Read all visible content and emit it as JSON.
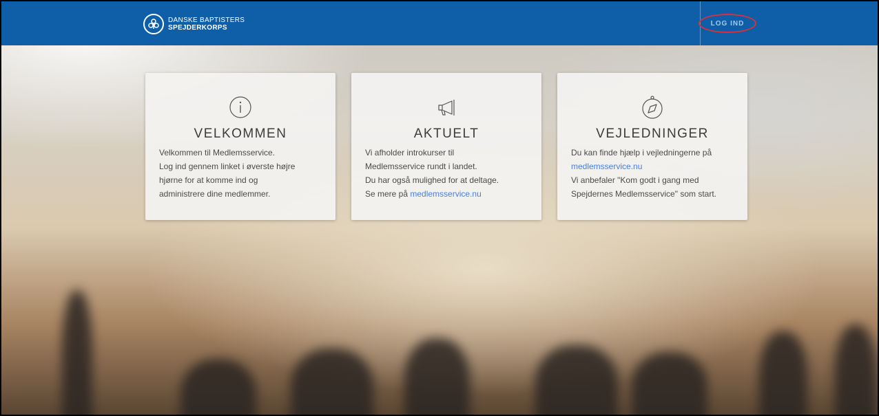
{
  "header": {
    "logo_line1": "DANSKE BAPTISTERS",
    "logo_line2": "SPEJDERKORPS",
    "login_label": "LOG IND"
  },
  "cards": [
    {
      "icon": "info-icon",
      "title": "VELKOMMEN",
      "lines": [
        "Velkommen til Medlemsservice.",
        "Log ind gennem linket i øverste højre",
        "hjørne for at komme ind og",
        "administrere dine medlemmer."
      ]
    },
    {
      "icon": "megaphone-icon",
      "title": "AKTUELT",
      "lines": [
        "Vi afholder introkurser til",
        "Medlemsservice rundt i landet.",
        "Du har også mulighed for at deltage."
      ],
      "link_prefix": "Se mere på ",
      "link_text": "medlemsservice.nu"
    },
    {
      "icon": "compass-icon",
      "title": "VEJLEDNINGER",
      "line1": "Du kan finde hjælp i vejledningerne på",
      "link_text": "medlemsservice.nu",
      "lines_after": [
        "Vi anbefaler \"Kom godt i gang med",
        "Spejdernes Medlemsservice\" som start."
      ]
    }
  ],
  "colors": {
    "topbar": "#0e5fa8",
    "link": "#4a7fd0",
    "login_highlight": "#d5333b"
  }
}
